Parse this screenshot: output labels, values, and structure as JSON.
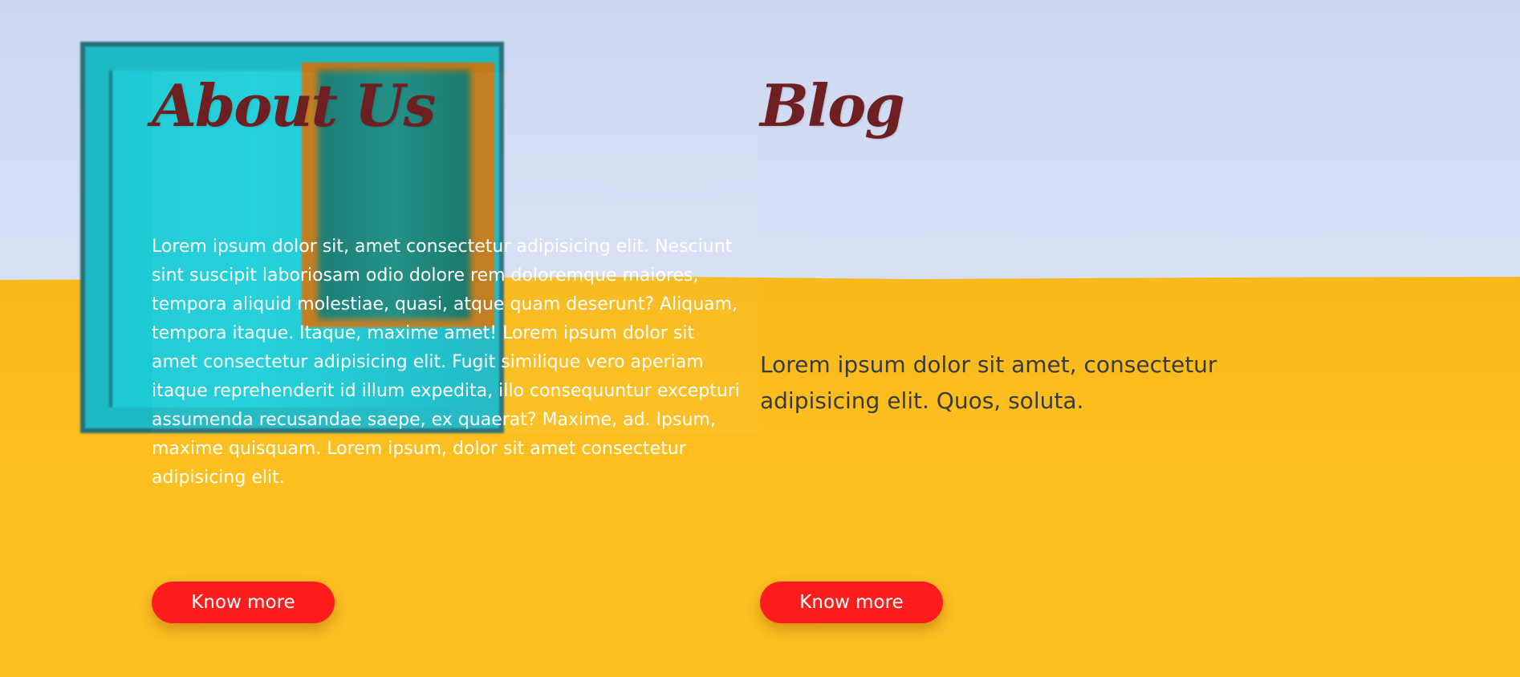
{
  "about": {
    "heading": "About Us",
    "body": "Lorem ipsum dolor sit, amet consectetur adipisicing elit. Nesciunt sint suscipit laboriosam odio dolore rem doloremque maiores, tempora aliquid molestiae, quasi, atque quam deserunt? Aliquam, tempora itaque. Itaque, maxime amet! Lorem ipsum dolor sit amet consectetur adipisicing elit. Fugit similique vero aperiam itaque reprehenderit id illum expedita, illo consequuntur excepturi assumenda recusandae saepe, ex quaerat? Maxime, ad. Ipsum, maxime quisquam. Lorem ipsum, dolor sit amet consectetur adipisicing elit.",
    "button_label": "Know more"
  },
  "blog": {
    "heading": "Blog",
    "body": "Lorem ipsum dolor sit amet, consectetur adipisicing elit. Quos, soluta.",
    "button_label": "Know more"
  },
  "colors": {
    "heading": "#6e1f22",
    "button": "#fe1d1d",
    "wall": "#fbbd1e",
    "sky": "#d2dcf3"
  }
}
